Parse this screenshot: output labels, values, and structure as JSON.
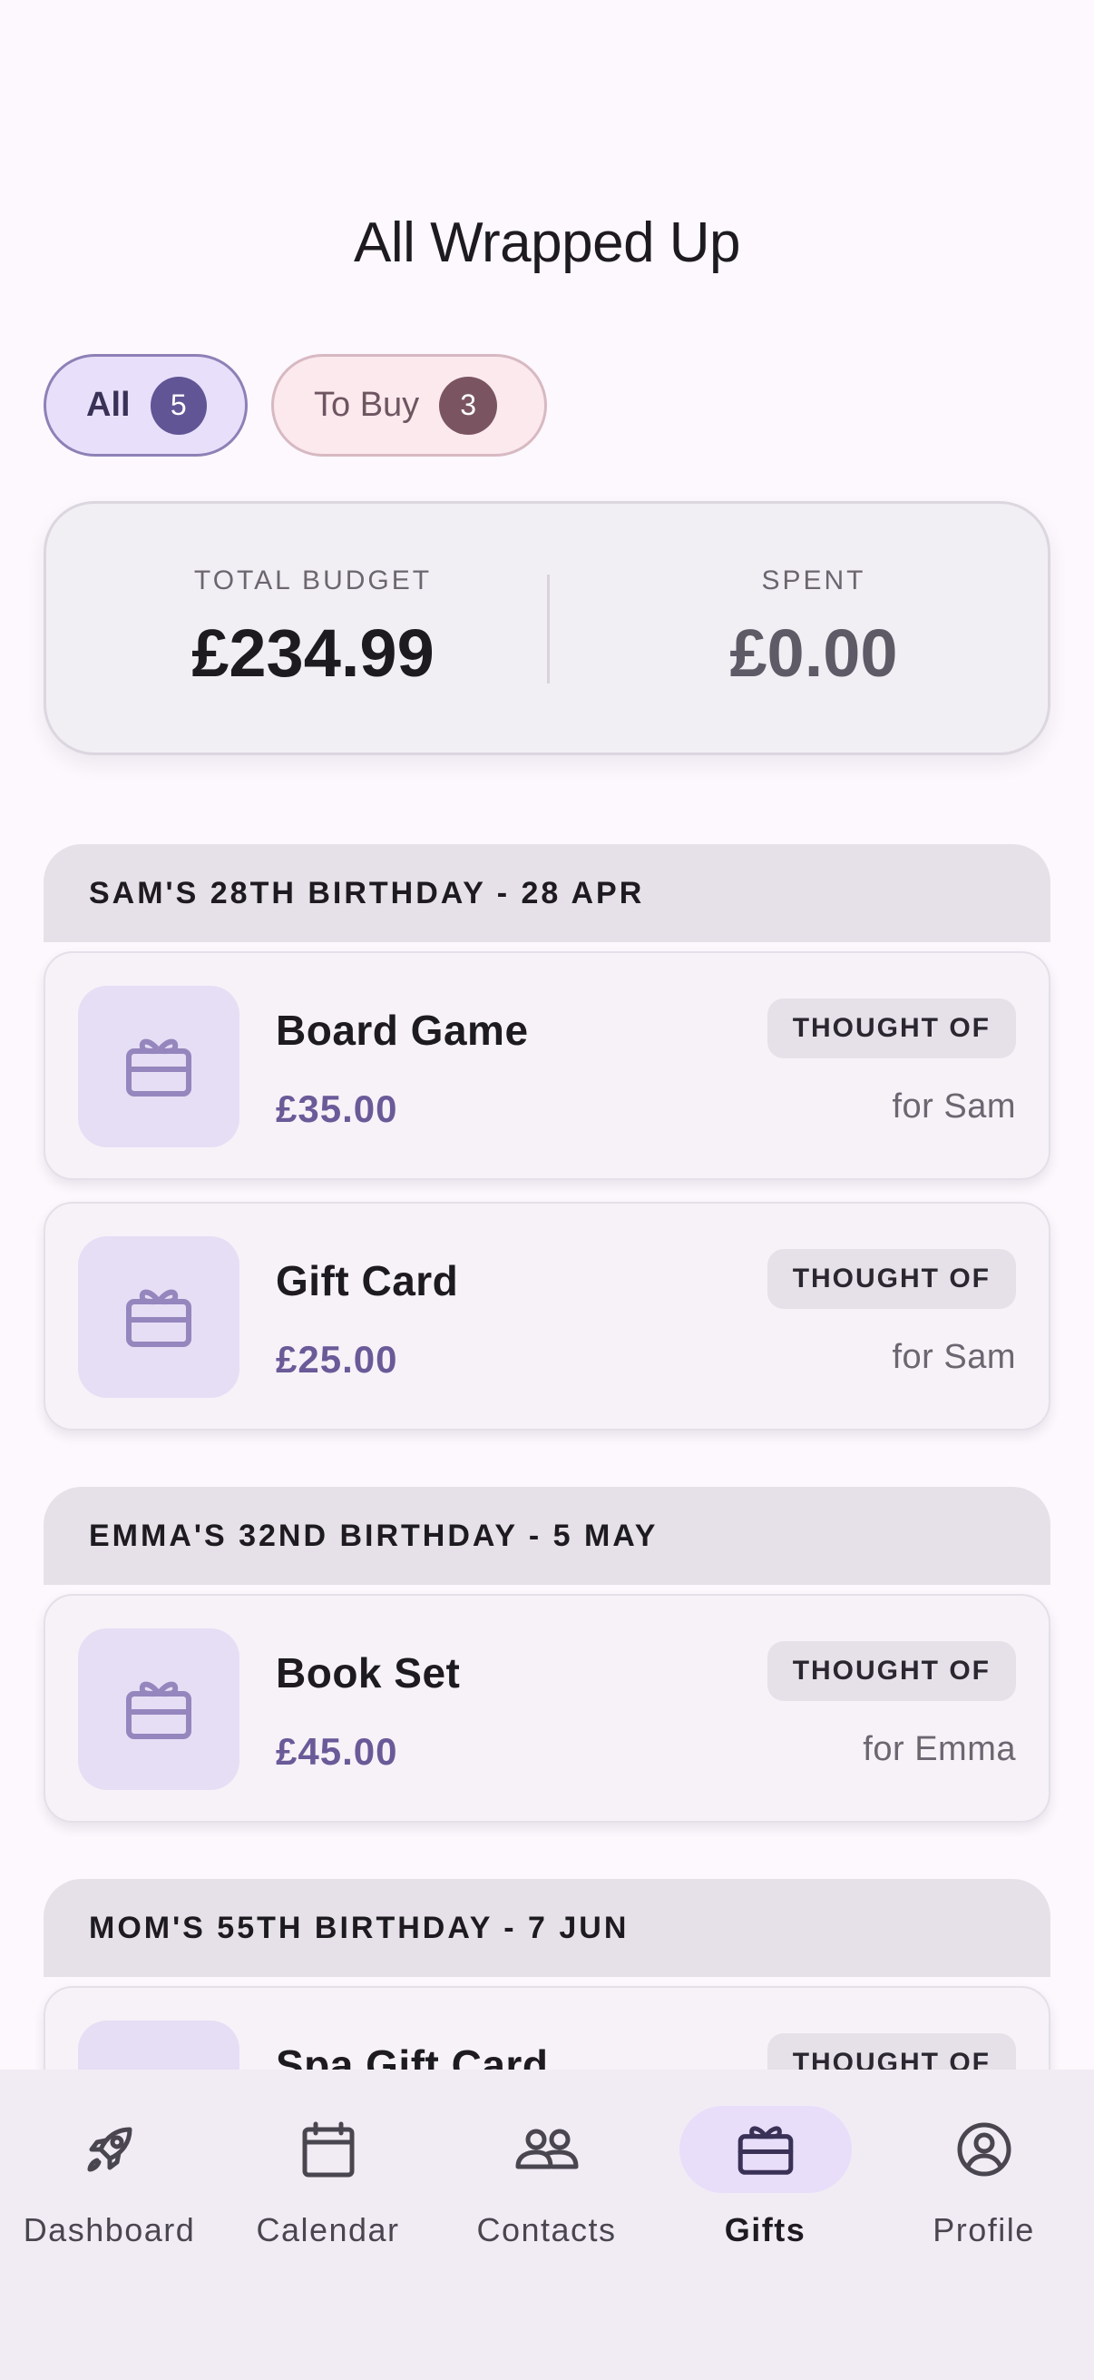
{
  "header": {
    "title": "All Wrapped Up"
  },
  "filters": [
    {
      "label": "All",
      "count": "5"
    },
    {
      "label": "To Buy",
      "count": "3"
    }
  ],
  "budget": {
    "total_label": "TOTAL BUDGET",
    "total_value": "£234.99",
    "spent_label": "SPENT",
    "spent_value": "£0.00"
  },
  "groups": [
    {
      "title": "SAM'S 28TH BIRTHDAY  -  28 APR",
      "gifts": [
        {
          "name": "Board Game",
          "price": "£35.00",
          "status": "THOUGHT OF",
          "recipient": "for Sam"
        },
        {
          "name": "Gift Card",
          "price": "£25.00",
          "status": "THOUGHT OF",
          "recipient": "for Sam"
        }
      ]
    },
    {
      "title": "EMMA'S 32ND BIRTHDAY  -  5 MAY",
      "gifts": [
        {
          "name": "Book Set",
          "price": "£45.00",
          "status": "THOUGHT OF",
          "recipient": "for Emma"
        }
      ]
    },
    {
      "title": "MOM'S 55TH BIRTHDAY  -  7 JUN",
      "gifts": [
        {
          "name": "Spa Gift Card",
          "price": "",
          "status": "THOUGHT OF",
          "recipient": ""
        }
      ]
    }
  ],
  "nav": [
    {
      "label": "Dashboard",
      "icon": "rocket-icon"
    },
    {
      "label": "Calendar",
      "icon": "calendar-icon"
    },
    {
      "label": "Contacts",
      "icon": "people-icon"
    },
    {
      "label": "Gifts",
      "icon": "gift-icon",
      "active": true
    },
    {
      "label": "Profile",
      "icon": "profile-icon"
    }
  ],
  "colors": {
    "accent": "#615596",
    "price": "#6a5a98",
    "background": "#fcf8fd"
  }
}
